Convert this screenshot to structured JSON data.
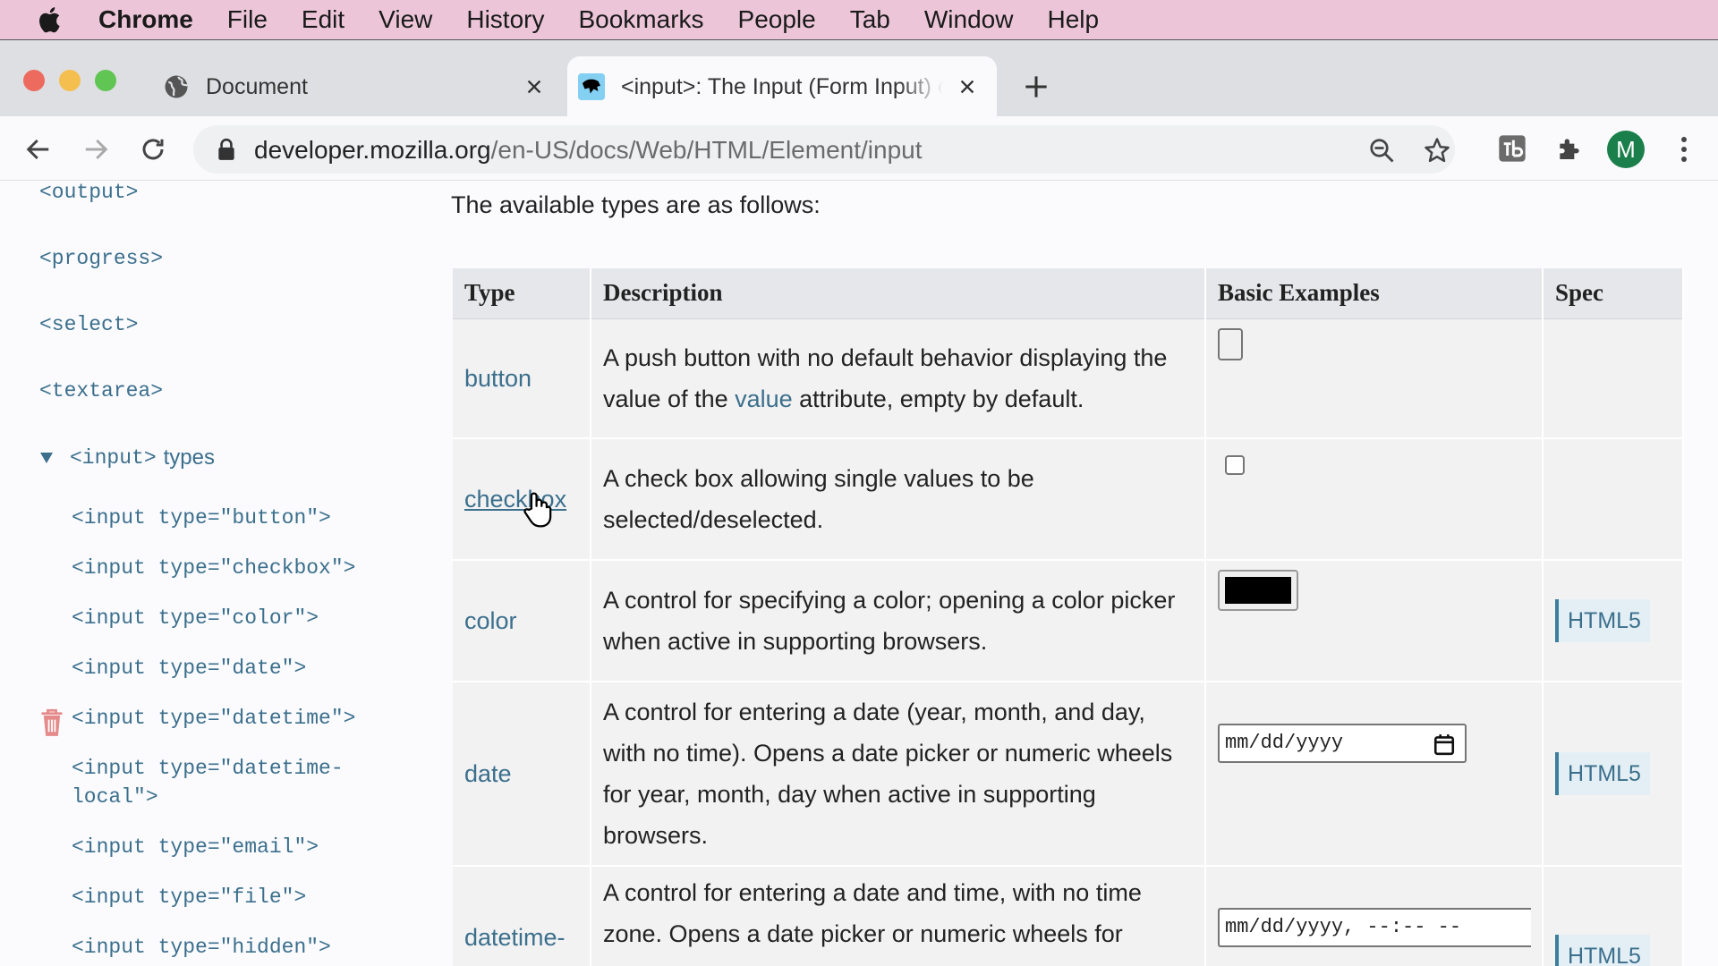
{
  "menubar": {
    "items": [
      "Chrome",
      "File",
      "Edit",
      "View",
      "History",
      "Bookmarks",
      "People",
      "Tab",
      "Window",
      "Help"
    ]
  },
  "tabs": [
    {
      "title": "Document",
      "favicon": "globe-icon"
    },
    {
      "title": "<input>: The Input (Form Input) element - HTML: HyperText Markup Language | MDN",
      "favicon": "mdn-icon"
    }
  ],
  "address_bar": {
    "domain": "developer.mozilla.org",
    "path": "/en-US/docs/Web/HTML/Element/input"
  },
  "profile": {
    "initial": "M",
    "color": "#1a7f4b"
  },
  "sidebar": {
    "items": [
      "<output>",
      "<progress>",
      "<select>",
      "<textarea>"
    ],
    "group": {
      "code": "<input>",
      "label": "types"
    },
    "subitems": [
      "<input type=\"button\">",
      "<input type=\"checkbox\">",
      "<input type=\"color\">",
      "<input type=\"date\">",
      "<input type=\"datetime\">",
      "<input type=\"datetime-",
      "local\">",
      "<input type=\"email\">",
      "<input type=\"file\">",
      "<input type=\"hidden\">"
    ]
  },
  "main": {
    "intro": "The available types are as follows:",
    "headers": [
      "Type",
      "Description",
      "Basic Examples",
      "Spec"
    ],
    "rows": [
      {
        "type": "button",
        "desc_before": "A push button with no default behavior displaying the value of the ",
        "desc_link": "value",
        "desc_after": " attribute, empty by default.",
        "spec": ""
      },
      {
        "type": "checkbox",
        "desc": "A check box allowing single values to be selected/deselected.",
        "spec": ""
      },
      {
        "type": "color",
        "desc": "A control for specifying a color; opening a color picker when active in supporting browsers.",
        "spec": "HTML5"
      },
      {
        "type": "date",
        "desc": "A control for entering a date (year, month, and day, with no time). Opens a date picker or numeric wheels for year, month, day when active in supporting browsers.",
        "spec": "HTML5",
        "example": "mm/dd/yyyy"
      },
      {
        "type": "datetime-",
        "desc": "A control for entering a date and time, with no time zone. Opens a date picker or numeric wheels for",
        "spec": "HTML5",
        "example": "mm/dd/yyyy, --:-- --"
      }
    ]
  },
  "colors": {
    "link": "#3b6f8c",
    "menubar": "#ecc6d8",
    "table_header": "#e6e7ea"
  }
}
